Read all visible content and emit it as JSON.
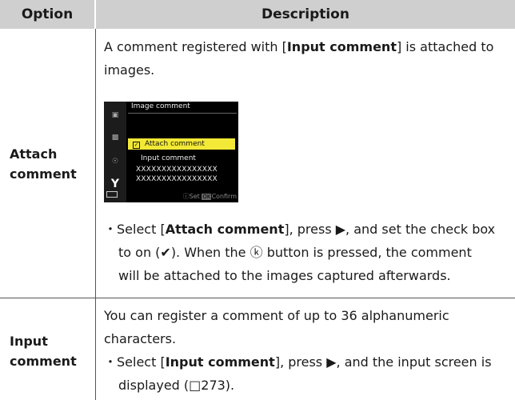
{
  "header": {
    "option": "Option",
    "description": "Description"
  },
  "rows": [
    {
      "option_line1": "Attach",
      "option_line2": "comment",
      "intro_pre": "A comment registered with [",
      "intro_bold": "Input comment",
      "intro_post": "] is attached to images.",
      "bullet": {
        "marker": "・Select [",
        "bold": "Attach comment",
        "after_bold": "], press ▶, and set the check box",
        "line2": "to on (✔). When the ⓚ button is pressed, the comment",
        "line3": "will be attached to the images captured afterwards."
      },
      "camera_screen": {
        "title": "Image comment",
        "highlighted_item": "Attach comment",
        "check_mark": "✓",
        "sub_label": "Input comment",
        "value_line1": "XXXXXXXXXXXXXXXX",
        "value_line2": "XXXXXXXXXXXXXXXX",
        "footer_set": "Set",
        "footer_ok": "OK",
        "footer_confirm": "Confirm",
        "side_icons": [
          "camera-icon",
          "movie-icon",
          "wireless-icon",
          "wrench-icon"
        ]
      }
    },
    {
      "option_line1": "Input",
      "option_line2": "comment",
      "intro_line1": "You can register a comment of up to 36 alphanumeric",
      "intro_line2": "characters.",
      "bullet": {
        "marker": "・Select [",
        "bold": "Input comment",
        "after_bold": "], press ▶, and the input screen is",
        "line2": "displayed (□273)."
      }
    }
  ]
}
